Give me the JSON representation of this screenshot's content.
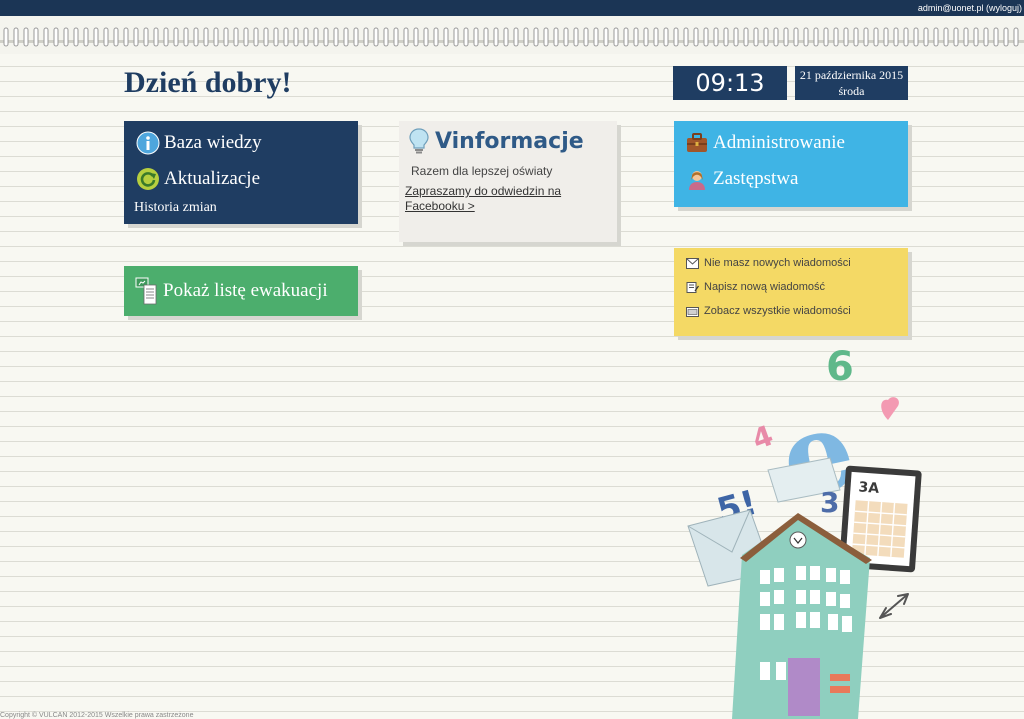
{
  "topbar": {
    "user_text": "admin@uonet.pl (wyloguj)"
  },
  "greeting": "Dzień dobry!",
  "clock": {
    "time": "09:13",
    "date": "21 października 2015",
    "weekday": "środa"
  },
  "knowledge": {
    "items": [
      {
        "label": "Baza wiedzy",
        "icon": "info-icon"
      },
      {
        "label": "Aktualizacje",
        "icon": "refresh-icon"
      }
    ],
    "history_label": "Historia zmian"
  },
  "vinformacje": {
    "title": "Vinformacje",
    "subtitle": "Razem dla lepszej oświaty",
    "facebook_link": "Zapraszamy do odwiedzin na Facebooku >"
  },
  "admin": {
    "items": [
      {
        "label": "Administrowanie",
        "icon": "briefcase-icon"
      },
      {
        "label": "Zastępstwa",
        "icon": "person-icon"
      }
    ]
  },
  "evacuation": {
    "label": "Pokaż listę ewakuacji"
  },
  "messages": {
    "items": [
      {
        "label": "Nie masz nowych wiadomości",
        "icon": "envelope-icon"
      },
      {
        "label": "Napisz nową wiadomość",
        "icon": "compose-icon"
      },
      {
        "label": "Zobacz wszystkie wiadomości",
        "icon": "folder-icon"
      }
    ]
  },
  "illustration": {
    "tablet_label": "3A"
  },
  "footer": {
    "text": "Copyright © VULCAN 2012-2015 Wszelkie prawa zastrzeżone"
  },
  "colors": {
    "navy": "#1f3d62",
    "sky_blue": "#3fb4e5",
    "green": "#4cae6d",
    "yellow": "#f4d965",
    "cream": "#f0eeea"
  }
}
